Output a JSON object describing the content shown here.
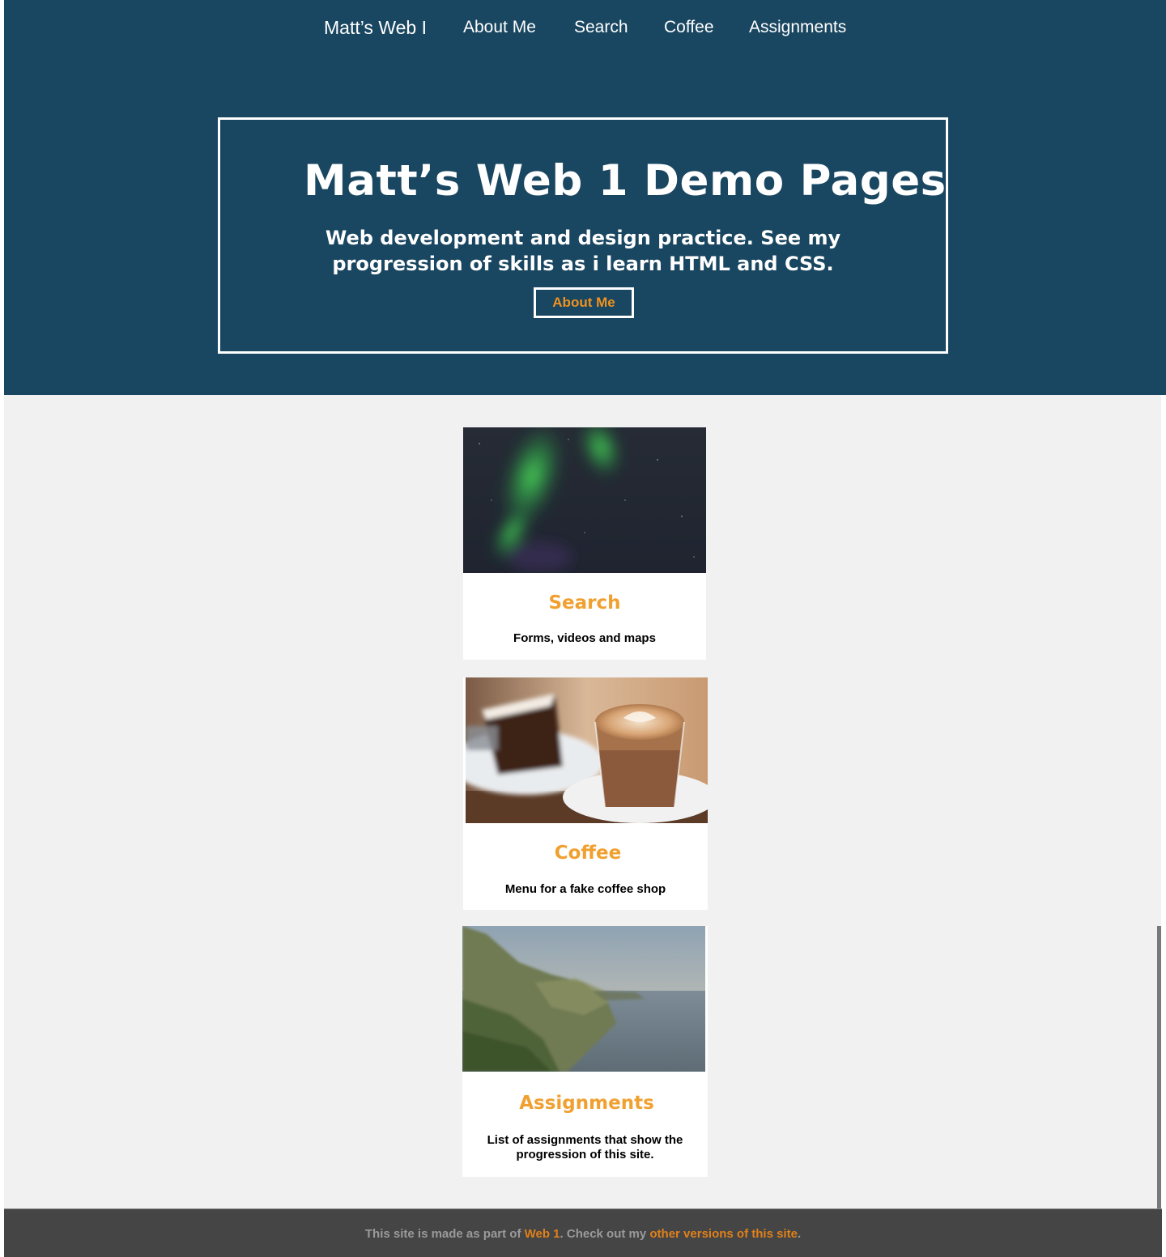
{
  "nav": {
    "brand": "Matt’s Web I",
    "items": [
      "About Me",
      "Search",
      "Coffee",
      "Assignments"
    ]
  },
  "hero": {
    "title": "Matt’s Web 1 Demo Pages",
    "subtitle": "Web development and design practice. See my progression of skills as i learn HTML and CSS.",
    "button_label": "About Me"
  },
  "cards": [
    {
      "title": "Search",
      "description": "Forms, videos and maps",
      "image": "northern-lights-photo"
    },
    {
      "title": "Coffee",
      "description": "Menu for a fake coffee shop",
      "image": "latte-and-cake-photo"
    },
    {
      "title": "Assignments",
      "description": "List of assignments that show the progression of this site.",
      "image": "coastal-cliffs-photo"
    }
  ],
  "footer": {
    "text_before": "This site is made as part of ",
    "link1": "Web 1",
    "text_middle": ". Check out my ",
    "link2": "other versions of this site",
    "text_after": "."
  },
  "colors": {
    "header_bg": "#194660",
    "accent": "#f0921e",
    "main_bg": "#f1f1f1",
    "footer_bg": "#454545"
  }
}
